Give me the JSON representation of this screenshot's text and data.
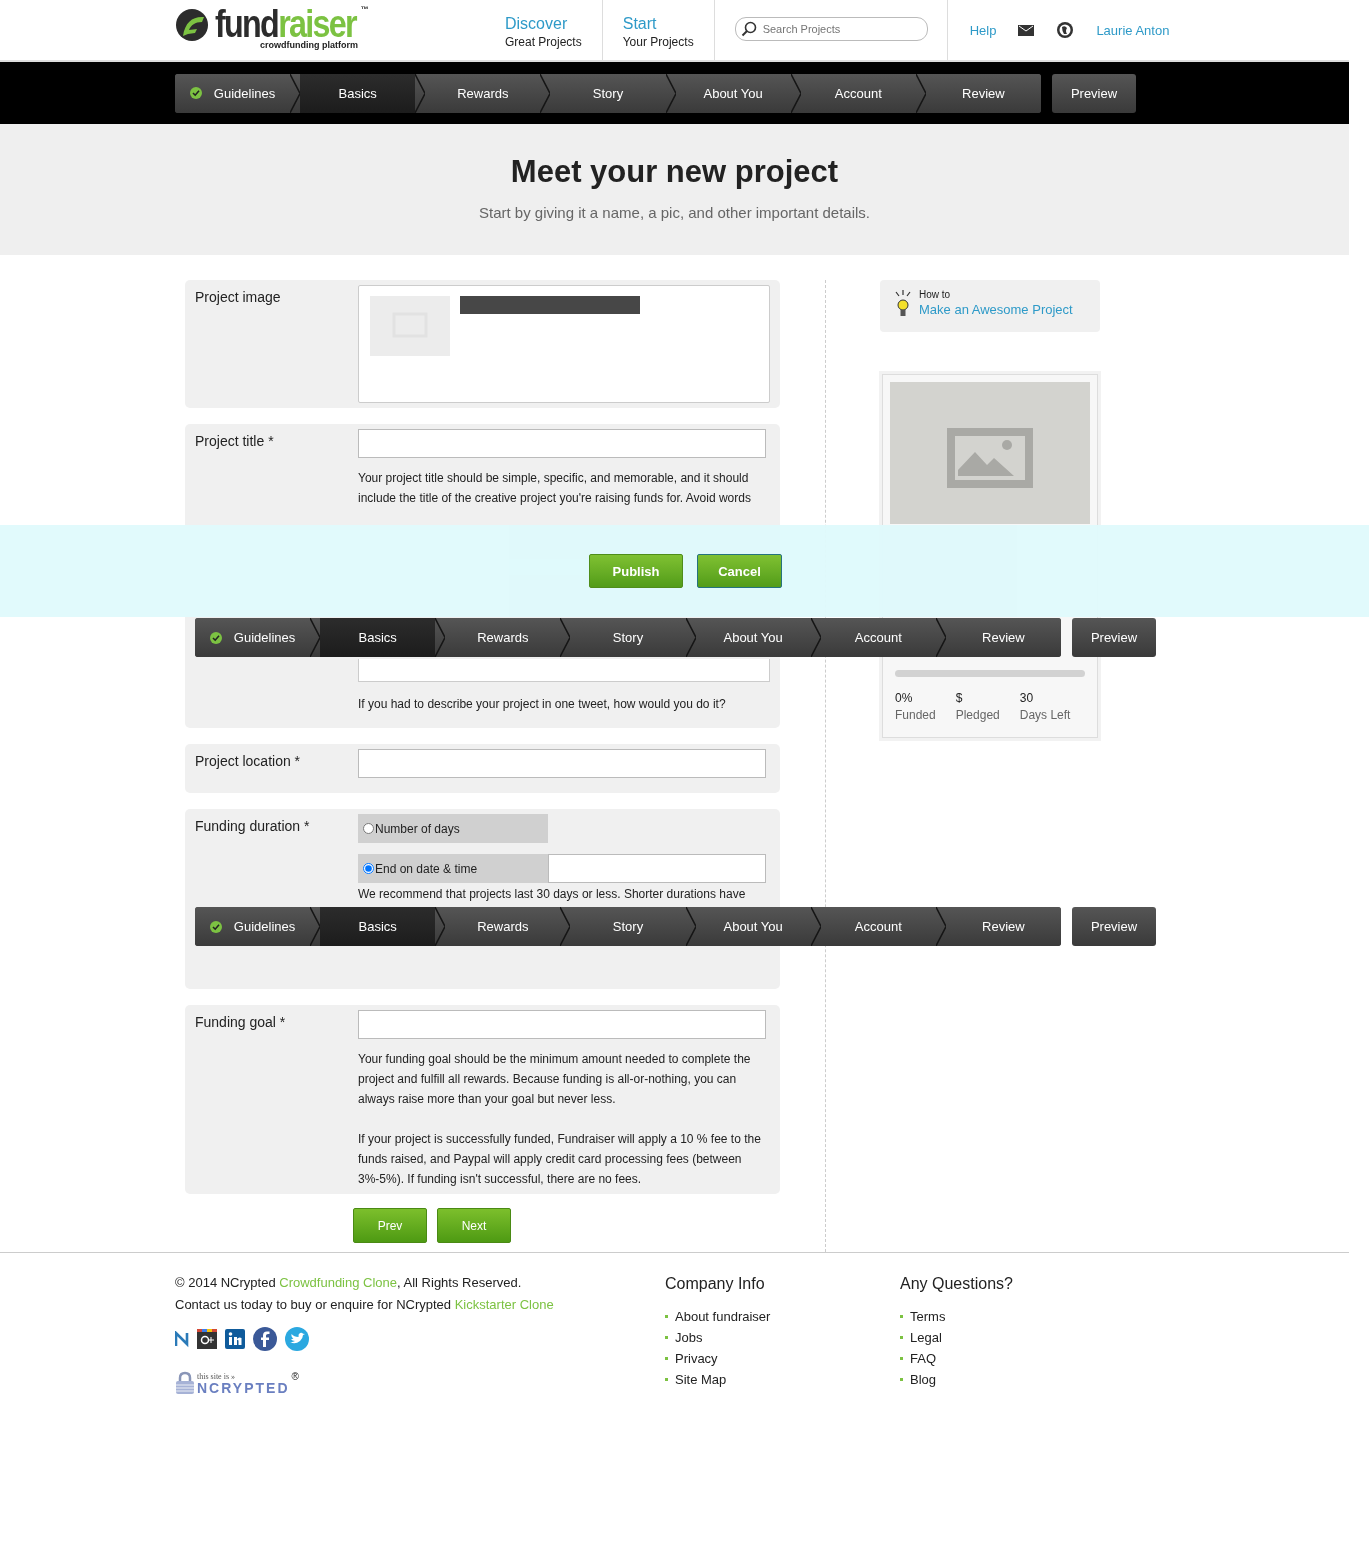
{
  "header": {
    "logo": {
      "dark": "fund",
      "green": "raiser",
      "tm": "™",
      "tagline": "crowdfunding platform"
    },
    "nav": [
      {
        "title": "Discover",
        "subtitle": "Great Projects"
      },
      {
        "title": "Start",
        "subtitle": "Your Projects"
      }
    ],
    "search": {
      "placeholder": "Search Projects"
    },
    "help": "Help",
    "user": "Laurie Anton"
  },
  "step_bars": [
    {
      "steps": [
        {
          "label": "Guidelines",
          "done": true,
          "selected": false
        },
        {
          "label": "Basics",
          "done": false,
          "selected": true
        },
        {
          "label": "Rewards",
          "done": false,
          "selected": false
        },
        {
          "label": "Story",
          "done": false,
          "selected": false
        },
        {
          "label": "About You",
          "done": false,
          "selected": false
        },
        {
          "label": "Account",
          "done": false,
          "selected": false
        },
        {
          "label": "Review",
          "done": false,
          "selected": false
        }
      ],
      "preview": "Preview"
    },
    {
      "steps": [
        {
          "label": "Guidelines",
          "done": true,
          "selected": false
        },
        {
          "label": "Basics",
          "done": false,
          "selected": true
        },
        {
          "label": "Rewards",
          "done": false,
          "selected": false
        },
        {
          "label": "Story",
          "done": false,
          "selected": false
        },
        {
          "label": "About You",
          "done": false,
          "selected": false
        },
        {
          "label": "Account",
          "done": false,
          "selected": false
        },
        {
          "label": "Review",
          "done": false,
          "selected": false
        }
      ],
      "preview": "Preview"
    },
    {
      "steps": [
        {
          "label": "Guidelines",
          "done": true,
          "selected": false
        },
        {
          "label": "Basics",
          "done": false,
          "selected": true
        },
        {
          "label": "Rewards",
          "done": false,
          "selected": false
        },
        {
          "label": "Story",
          "done": false,
          "selected": false
        },
        {
          "label": "About You",
          "done": false,
          "selected": false
        },
        {
          "label": "Account",
          "done": false,
          "selected": false
        },
        {
          "label": "Review",
          "done": false,
          "selected": false
        }
      ],
      "preview": "Preview"
    }
  ],
  "action_bar": {
    "buttons": [
      "Publish",
      "Cancel"
    ]
  },
  "hero": {
    "title": "Meet your new project",
    "subtitle": "Start by giving it a name, a pic, and other important details."
  },
  "form": [
    {
      "kind": "image",
      "label": "Project image"
    },
    {
      "kind": "text",
      "label": "Project title *",
      "hints": [
        "Your project title should be simple, specific, and memorable, and it should include the title of the creative project you're raising funds for. Avoid words"
      ]
    },
    {
      "kind": "textarea",
      "hints": [
        "If you had to describe your project in one tweet, how would you do it?"
      ]
    },
    {
      "kind": "text",
      "label": "Project location *"
    },
    {
      "kind": "radios",
      "label": "Funding duration *",
      "options": [
        {
          "label": "Number of days",
          "selected": false
        },
        {
          "label": "End on date & time",
          "selected": true
        }
      ],
      "hints": [
        "We recommend that projects last 30 days or less. Shorter durations have"
      ]
    },
    {
      "kind": "text",
      "label": "Funding goal *",
      "hints": [
        "Your funding goal should be the minimum amount needed to complete the project and fulfill all rewards. Because funding is all-or-nothing, you can always raise more than your goal but never less.",
        "If your project is successfully funded, Fundraiser will apply a 10 % fee to the funds raised, and Paypal will apply credit card processing fees (between 3%-5%). If funding isn't successful, there are no fees."
      ]
    }
  ],
  "form_buttons": [
    "Prev",
    "Next"
  ],
  "sidebar": {
    "tip": {
      "small": "How to",
      "link": "Make an Awesome Project"
    },
    "progress": {
      "level": 0
    },
    "stats": [
      {
        "value": "0%",
        "label": "Funded"
      },
      {
        "value": "$",
        "label": "Pledged"
      },
      {
        "value": "30",
        "label": "Days Left"
      }
    ]
  },
  "footer": {
    "lines": [
      {
        "before": "© 2014 NCrypted ",
        "link": "Crowdfunding Clone",
        "after": ", All Rights Reserved."
      },
      {
        "before": "Contact us today to buy or enquire for NCrypted ",
        "link": "Kickstarter Clone"
      }
    ],
    "badge": {
      "small": "this site is »",
      "big": "NCRYPTED",
      "mark": "®"
    },
    "columns": [
      {
        "title": "Company Info",
        "links": [
          "About fundraiser",
          "Jobs",
          "Privacy",
          "Site Map"
        ]
      },
      {
        "title": "Any Questions?",
        "links": [
          "Terms",
          "Legal",
          "FAQ",
          "Blog"
        ]
      }
    ]
  }
}
